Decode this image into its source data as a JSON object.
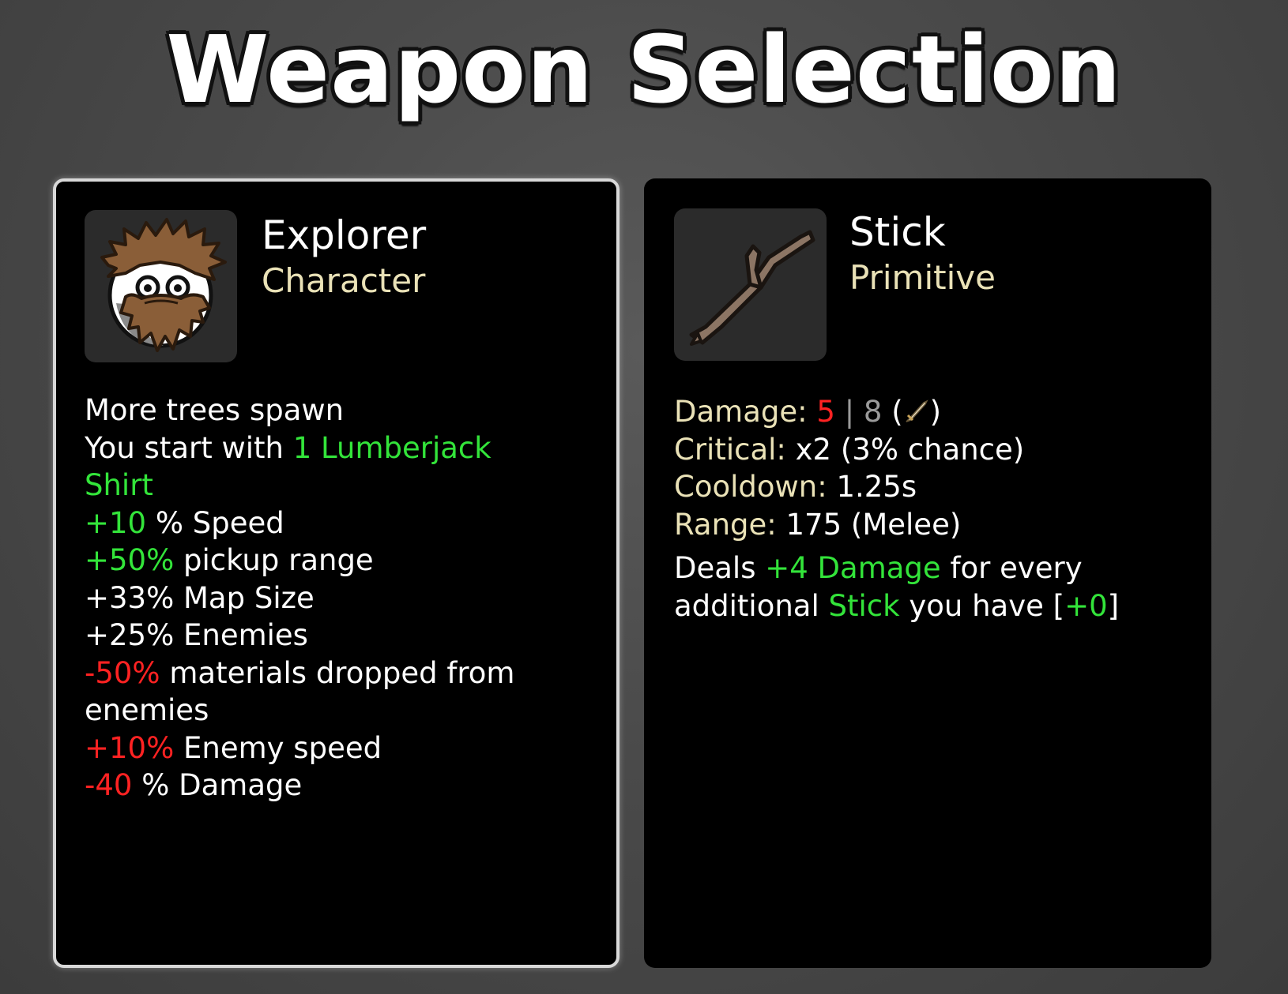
{
  "title": "Weapon Selection",
  "character": {
    "name": "Explorer",
    "type": "Character",
    "icon": "explorer-character-icon",
    "effects": {
      "trees": "More trees spawn",
      "start_prefix": "You start with ",
      "start_item": "1 Lumberjack Shirt",
      "speed_value": "+10",
      "speed_label": " % Speed",
      "pickup_value": "+50%",
      "pickup_label": " pickup range",
      "map_size": "+33% Map Size",
      "enemies": "+25% Enemies",
      "materials_value": "-50%",
      "materials_label": " materials dropped from enemies",
      "enemy_speed_value": "+10%",
      "enemy_speed_label": " Enemy speed",
      "damage_value": "-40",
      "damage_label": " % Damage"
    }
  },
  "weapon": {
    "name": "Stick",
    "type": "Primitive",
    "icon": "stick-weapon-icon",
    "stats": {
      "damage_label": "Damage:",
      "damage_value": "5",
      "damage_sep": "|",
      "damage_base": "8",
      "damage_scaling_icon": "sword-icon",
      "critical_label": "Critical:",
      "critical_value": "x2 (3% chance)",
      "cooldown_label": "Cooldown:",
      "cooldown_value": "1.25s",
      "range_label": "Range:",
      "range_value": "175 (Melee)"
    },
    "special": {
      "prefix": "Deals ",
      "bonus": "+4 Damage",
      "middle": " for every additional ",
      "item": "Stick",
      "suffix": " you have [",
      "count": "+0",
      "end": "]"
    }
  },
  "colors": {
    "positive": "#33e43a",
    "negative": "#ff2222",
    "label": "#eae2b7",
    "panel_border": "#d8d8d8"
  }
}
